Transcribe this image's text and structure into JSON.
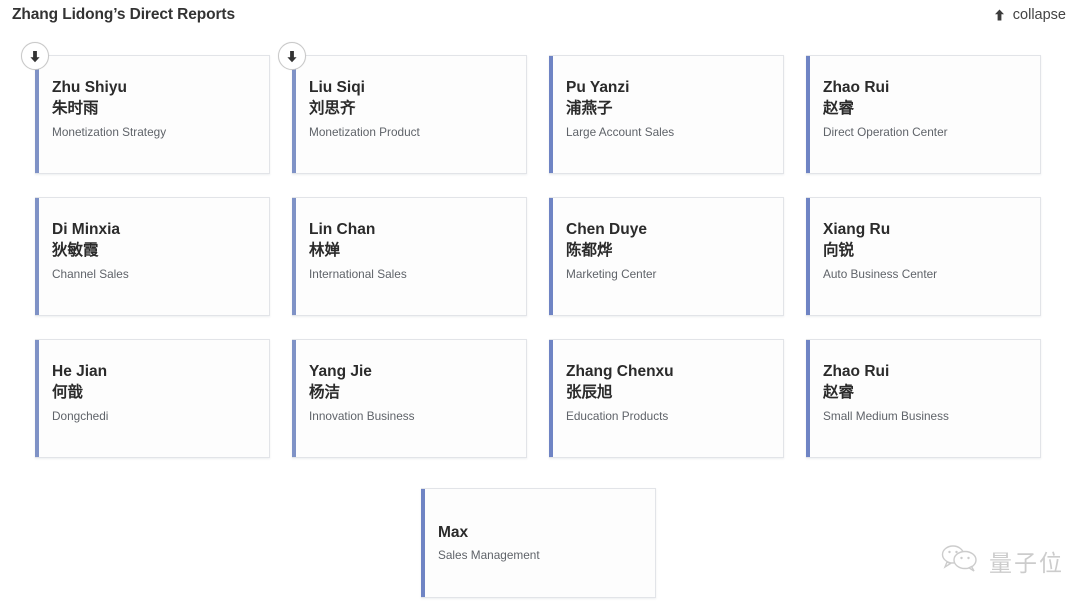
{
  "header": {
    "title": "Zhang Lidong’s Direct Reports",
    "collapse_label": "collapse",
    "collapse_icon": "arrow-up-icon"
  },
  "colors": {
    "accent_bar": "#7f92c6",
    "accent_bar_strong": "#6f84c4",
    "card_border": "#e2e4e8",
    "card_background": "#fdfdfd",
    "name_text": "#2b2b2b",
    "dept_text": "#5f6369",
    "title_text": "#333333"
  },
  "cards": [
    {
      "name_en": "Zhu Shiyu",
      "name_cn": "朱时雨",
      "dept": "Monetization Strategy",
      "has_expand": true,
      "expand_icon": "arrow-down-icon"
    },
    {
      "name_en": "Liu Siqi",
      "name_cn": "刘思齐",
      "dept": "Monetization Product",
      "has_expand": true,
      "expand_icon": "arrow-down-icon"
    },
    {
      "name_en": "Pu Yanzi",
      "name_cn": "浦燕子",
      "dept": "Large Account Sales",
      "has_expand": false
    },
    {
      "name_en": "Zhao Rui",
      "name_cn": "赵睿",
      "dept": "Direct Operation Center",
      "has_expand": false
    },
    {
      "name_en": "Di Minxia",
      "name_cn": "狄敏霞",
      "dept": "Channel Sales",
      "has_expand": false
    },
    {
      "name_en": "Lin Chan",
      "name_cn": "林婵",
      "dept": "International Sales",
      "has_expand": false
    },
    {
      "name_en": "Chen Duye",
      "name_cn": "陈都烨",
      "dept": "Marketing Center",
      "has_expand": false
    },
    {
      "name_en": "Xiang Ru",
      "name_cn": "向锐",
      "dept": "Auto Business Center",
      "has_expand": false
    },
    {
      "name_en": "He Jian",
      "name_cn": "何戠",
      "dept": "Dongchedi",
      "has_expand": false
    },
    {
      "name_en": "Yang Jie",
      "name_cn": "杨洁",
      "dept": "Innovation Business",
      "has_expand": false
    },
    {
      "name_en": "Zhang Chenxu",
      "name_cn": "张辰旭",
      "dept": "Education Products",
      "has_expand": false
    },
    {
      "name_en": "Zhao Rui",
      "name_cn": "赵睿",
      "dept": "Small Medium Business",
      "has_expand": false
    }
  ],
  "bottom_card": {
    "name_en": "Max",
    "name_cn": "",
    "dept": "Sales Management",
    "has_expand": false
  },
  "watermark": {
    "text": "量子位",
    "icon": "wechat-logo-icon"
  }
}
